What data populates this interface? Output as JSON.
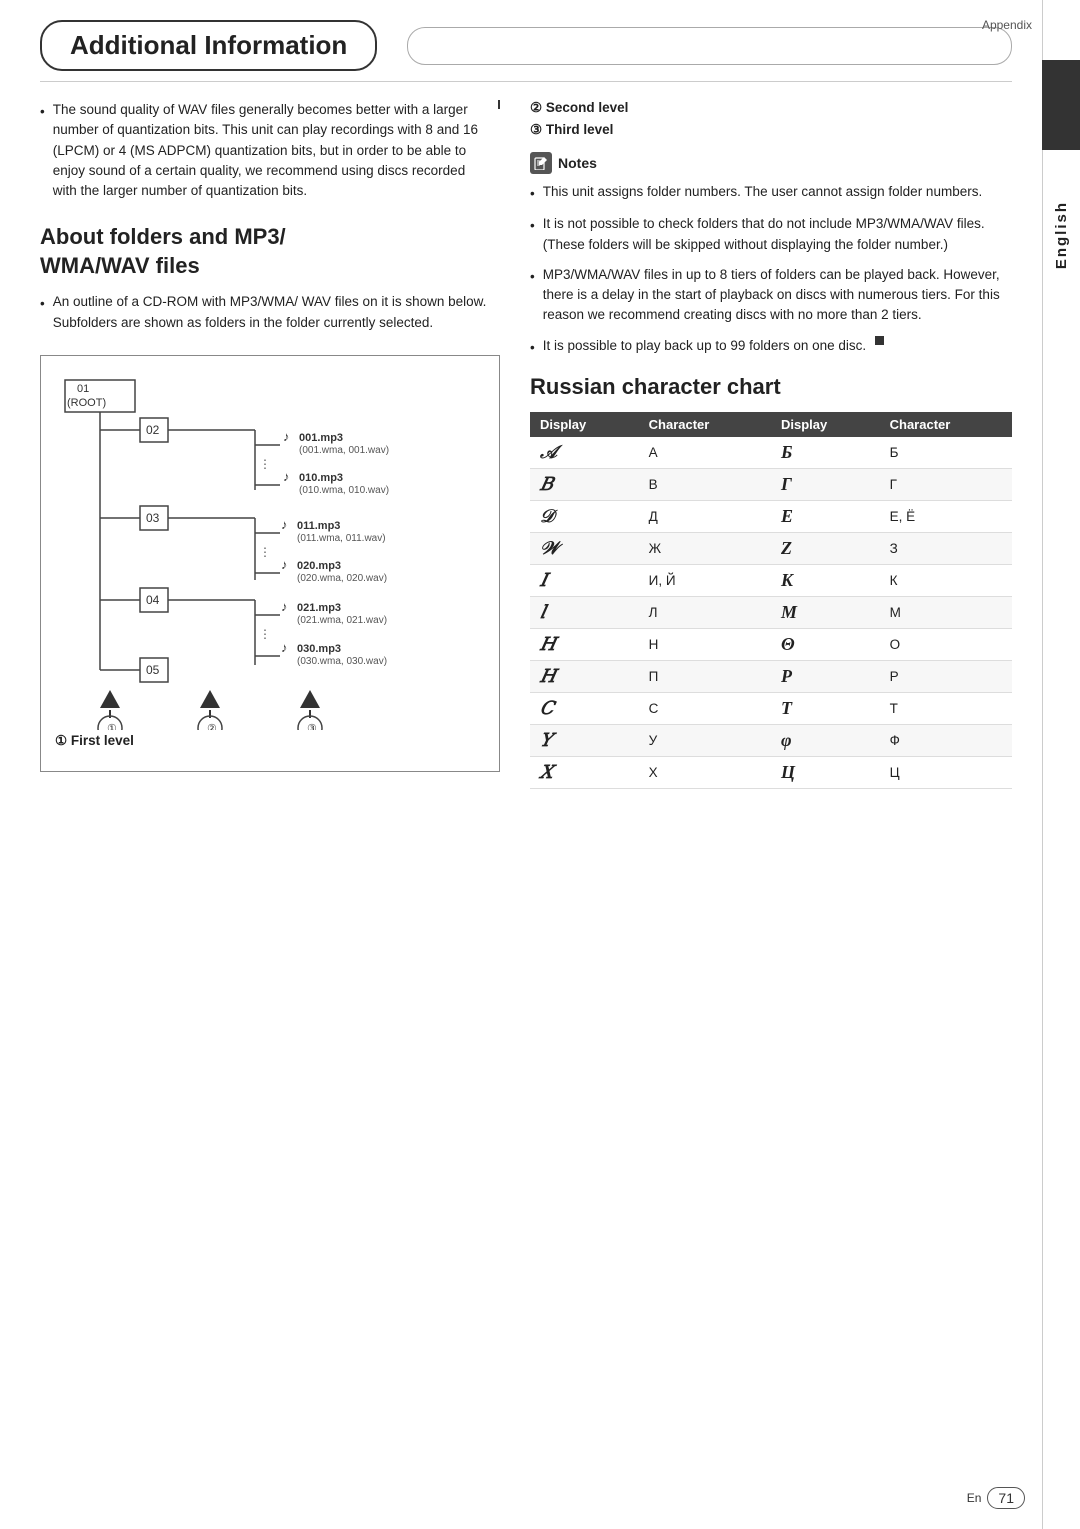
{
  "page": {
    "appendix_label": "Appendix",
    "title": "Additional Information",
    "language_tab": "English",
    "page_number": "71",
    "en_label": "En"
  },
  "left_column": {
    "intro_bullet": "The sound quality of WAV files generally becomes better with a larger number of quantization bits. This unit can play recordings with 8 and 16 (LPCM) or 4 (MS ADPCM) quantization bits, but in order to be able to enjoy sound of a certain quality, we recommend using discs recorded with the larger number of quantization bits.",
    "section_title_line1": "About folders and MP3/",
    "section_title_line2": "WMA/WAV files",
    "folders_bullet": "An outline of a CD-ROM with MP3/WMA/ WAV files on it is shown below. Subfolders are shown as folders in the folder currently selected.",
    "level_labels": [
      {
        "num": "①",
        "label": "First level"
      },
      {
        "num": "②",
        "label": "Second level"
      },
      {
        "num": "③",
        "label": "Third level"
      }
    ],
    "first_level_label": "① First level"
  },
  "right_column": {
    "second_level": "② Second level",
    "third_level": "③ Third level",
    "notes_title": "Notes",
    "notes_icon": "✎",
    "notes": [
      "This unit assigns folder numbers. The user cannot assign folder numbers.",
      "It is not possible to check folders that do not include MP3/WMA/WAV files. (These folders will be skipped without displaying the folder number.)",
      "MP3/WMA/WAV files in up to 8 tiers of folders can be played back. However, there is a delay in the start of playback on discs with numerous tiers. For this reason we recommend creating discs with no more than 2 tiers.",
      "It is possible to play back up to 99 folders on one disc."
    ],
    "russian_chart_title": "Russian character chart",
    "table_headers": [
      "Display",
      "Character",
      "Display",
      "Character"
    ],
    "table_rows": [
      {
        "d1": "𝐴",
        "c1": "А",
        "d2": "Б̃",
        "c2": "Б"
      },
      {
        "d1": "𝐵",
        "c1": "В",
        "d2": "Г̃",
        "c2": "Г"
      },
      {
        "d1": "Д̃",
        "c1": "Д",
        "d2": "Е̃",
        "c2": "Е, Ё"
      },
      {
        "d1": "Ж̃",
        "c1": "Ж",
        "d2": "З̃",
        "c2": "З"
      },
      {
        "d1": "И̃",
        "c1": "И, Й",
        "d2": "К̃",
        "c2": "К"
      },
      {
        "d1": "Л̃",
        "c1": "Л",
        "d2": "М̃",
        "c2": "М"
      },
      {
        "d1": "Н̃",
        "c1": "Н",
        "d2": "О̃",
        "c2": "О"
      },
      {
        "d1": "П̃",
        "c1": "П",
        "d2": "Р̃",
        "c2": "Р"
      },
      {
        "d1": "С̃",
        "c1": "С",
        "d2": "Т̃",
        "c2": "Т"
      },
      {
        "d1": "У̃",
        "c1": "У",
        "d2": "Ф̃",
        "c2": "Ф"
      },
      {
        "d1": "Х̃",
        "c1": "Х",
        "d2": "Ц̃",
        "c2": "Ц"
      }
    ]
  },
  "folder_diagram": {
    "root_label": "01\n(ROOT)",
    "nodes": [
      {
        "id": "02",
        "label": "02",
        "depth": 1
      },
      {
        "id": "001",
        "label": "001.mp3",
        "sub": "(001.wma, 001.wav)",
        "depth": 2
      },
      {
        "id": "010",
        "label": "010.mp3",
        "sub": "(010.wma, 010.wav)",
        "depth": 2
      },
      {
        "id": "03",
        "label": "03",
        "depth": 1
      },
      {
        "id": "011",
        "label": "011.mp3",
        "sub": "(011.wma, 011.wav)",
        "depth": 2
      },
      {
        "id": "020",
        "label": "020.mp3",
        "sub": "(020.wma, 020.wav)",
        "depth": 2
      },
      {
        "id": "04",
        "label": "04",
        "depth": 1
      },
      {
        "id": "021",
        "label": "021.mp3",
        "sub": "(021.wma, 021.wav)",
        "depth": 2
      },
      {
        "id": "030",
        "label": "030.mp3",
        "sub": "(030.wma, 030.wav)",
        "depth": 2
      },
      {
        "id": "05",
        "label": "05",
        "depth": 1
      }
    ]
  }
}
